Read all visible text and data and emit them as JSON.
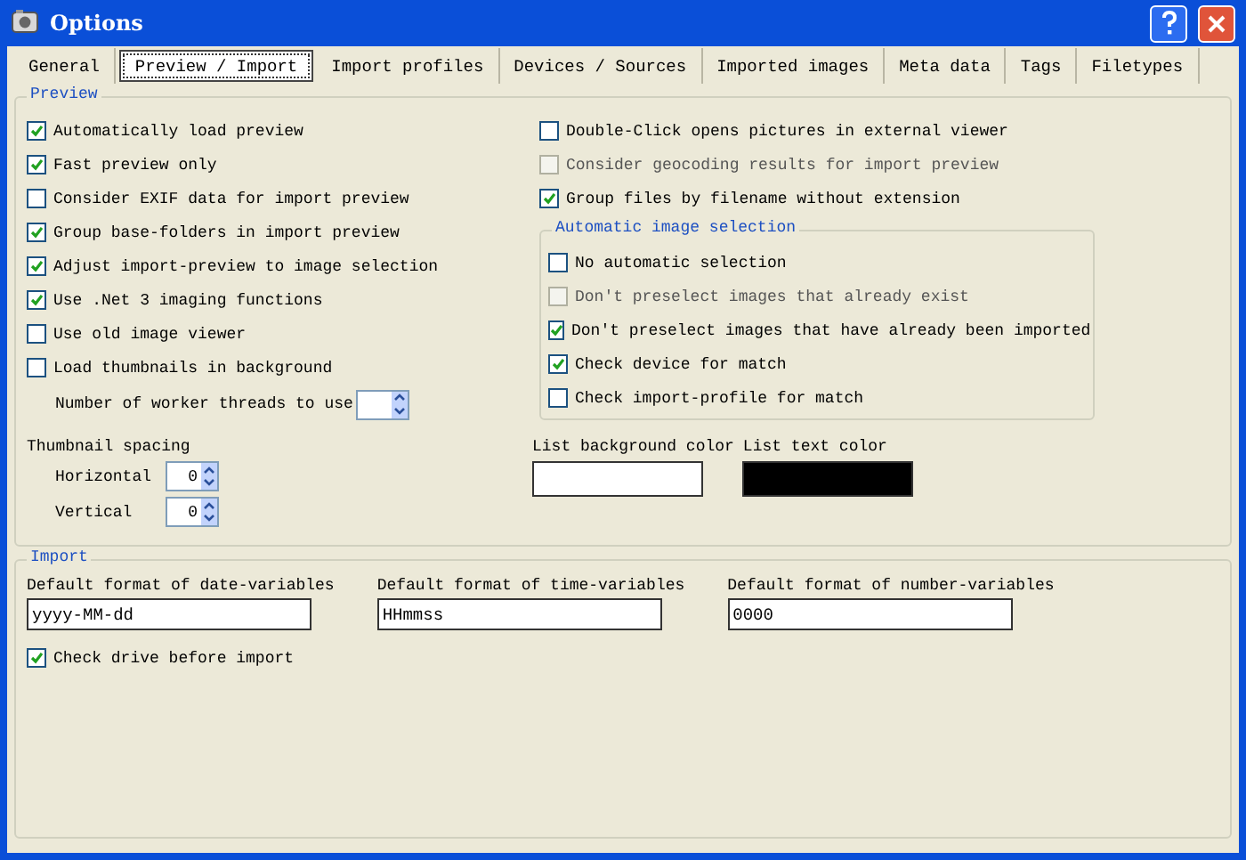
{
  "window": {
    "title": "Options"
  },
  "tabs": [
    {
      "label": "General",
      "selected": false
    },
    {
      "label": "Preview / Import",
      "selected": true
    },
    {
      "label": "Import profiles",
      "selected": false
    },
    {
      "label": "Devices / Sources",
      "selected": false
    },
    {
      "label": "Imported images",
      "selected": false
    },
    {
      "label": "Meta data",
      "selected": false
    },
    {
      "label": "Tags",
      "selected": false
    },
    {
      "label": "Filetypes",
      "selected": false
    }
  ],
  "preview": {
    "title": "Preview",
    "left_options": [
      {
        "label": "Automatically load preview",
        "checked": true,
        "disabled": false
      },
      {
        "label": "Fast preview only",
        "checked": true,
        "disabled": false
      },
      {
        "label": "Consider EXIF data for import preview",
        "checked": false,
        "disabled": false
      },
      {
        "label": "Group base-folders in import preview",
        "checked": true,
        "disabled": false
      },
      {
        "label": "Adjust import-preview to image selection",
        "checked": true,
        "disabled": false
      },
      {
        "label": "Use .Net 3 imaging functions",
        "checked": true,
        "disabled": false
      },
      {
        "label": "Use old image viewer",
        "checked": false,
        "disabled": false
      },
      {
        "label": "Load thumbnails in background",
        "checked": false,
        "disabled": false
      }
    ],
    "worker_threads": {
      "label": "Number of worker threads to use"
    },
    "right_options": [
      {
        "label": "Double-Click opens pictures in external viewer",
        "checked": false,
        "disabled": false
      },
      {
        "label": "Consider geocoding results for import preview",
        "checked": false,
        "disabled": true
      },
      {
        "label": "Group files by filename without extension",
        "checked": true,
        "disabled": false
      }
    ],
    "auto_selection": {
      "title": "Automatic image selection",
      "options": [
        {
          "label": "No automatic selection",
          "checked": false,
          "disabled": false
        },
        {
          "label": "Don't preselect images that already exist",
          "checked": false,
          "disabled": true
        },
        {
          "label": "Don't preselect images that have already been imported",
          "checked": true,
          "disabled": false
        },
        {
          "label": "Check device for match",
          "checked": true,
          "disabled": false
        },
        {
          "label": "Check import-profile for match",
          "checked": false,
          "disabled": false
        }
      ]
    },
    "thumbnail_spacing": {
      "title": "Thumbnail spacing",
      "fields": [
        {
          "label": "Horizontal",
          "value": "0"
        },
        {
          "label": "Vertical",
          "value": "0"
        }
      ]
    },
    "colors": [
      {
        "label": "List background color",
        "color": "#ffffff"
      },
      {
        "label": "List text color",
        "color": "#000000"
      }
    ]
  },
  "import": {
    "title": "Import",
    "fields": [
      {
        "label": "Default format of date-variables",
        "value": "yyyy-MM-dd"
      },
      {
        "label": "Default format of time-variables",
        "value": "HHmmss"
      },
      {
        "label": "Default format of number-variables",
        "value": "0000"
      }
    ],
    "options": [
      {
        "label": "Check drive before import",
        "checked": true,
        "disabled": false
      }
    ]
  }
}
